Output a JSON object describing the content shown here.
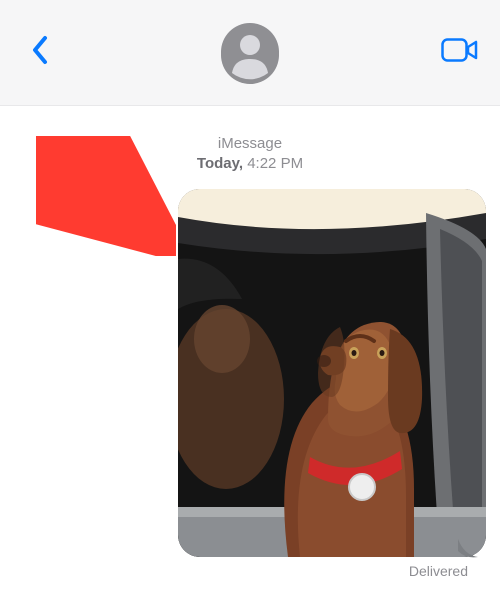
{
  "header": {
    "back_icon": "chevron-left",
    "avatar_icon": "person-circle",
    "video_icon": "video-camera"
  },
  "timestamp": {
    "service": "iMessage",
    "day": "Today,",
    "time": "4:22 PM"
  },
  "messages": [
    {
      "type": "image",
      "from_me": true,
      "description": "dog-in-car-window",
      "status": "Delivered"
    }
  ],
  "annotation": {
    "arrow_color": "#ff3b30",
    "points_at": "image-bubble"
  }
}
